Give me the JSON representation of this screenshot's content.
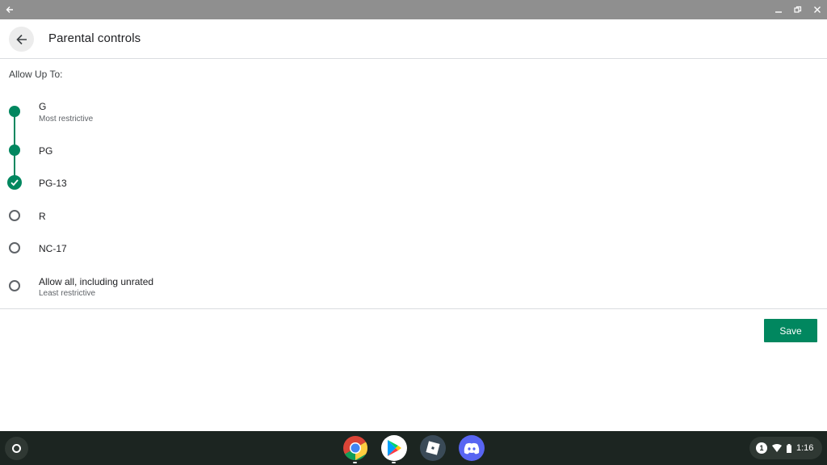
{
  "header": {
    "title": "Parental controls"
  },
  "section_label": "Allow Up To:",
  "ratings": [
    {
      "label": "G",
      "sub": "Most restrictive",
      "state": "allowed"
    },
    {
      "label": "PG",
      "sub": "",
      "state": "allowed"
    },
    {
      "label": "PG-13",
      "sub": "",
      "state": "selected"
    },
    {
      "label": "R",
      "sub": "",
      "state": "unselected"
    },
    {
      "label": "NC-17",
      "sub": "",
      "state": "unselected"
    },
    {
      "label": "Allow all, including unrated",
      "sub": "Least restrictive",
      "state": "unselected"
    }
  ],
  "save_label": "Save",
  "shelf": {
    "apps": [
      "chrome-icon",
      "play-store-icon",
      "roblox-icon",
      "discord-icon"
    ],
    "notification_count": "1",
    "time": "1:16"
  },
  "colors": {
    "accent": "#01875f",
    "caption": "#8f8f8f",
    "shelf": "#1c2521"
  }
}
